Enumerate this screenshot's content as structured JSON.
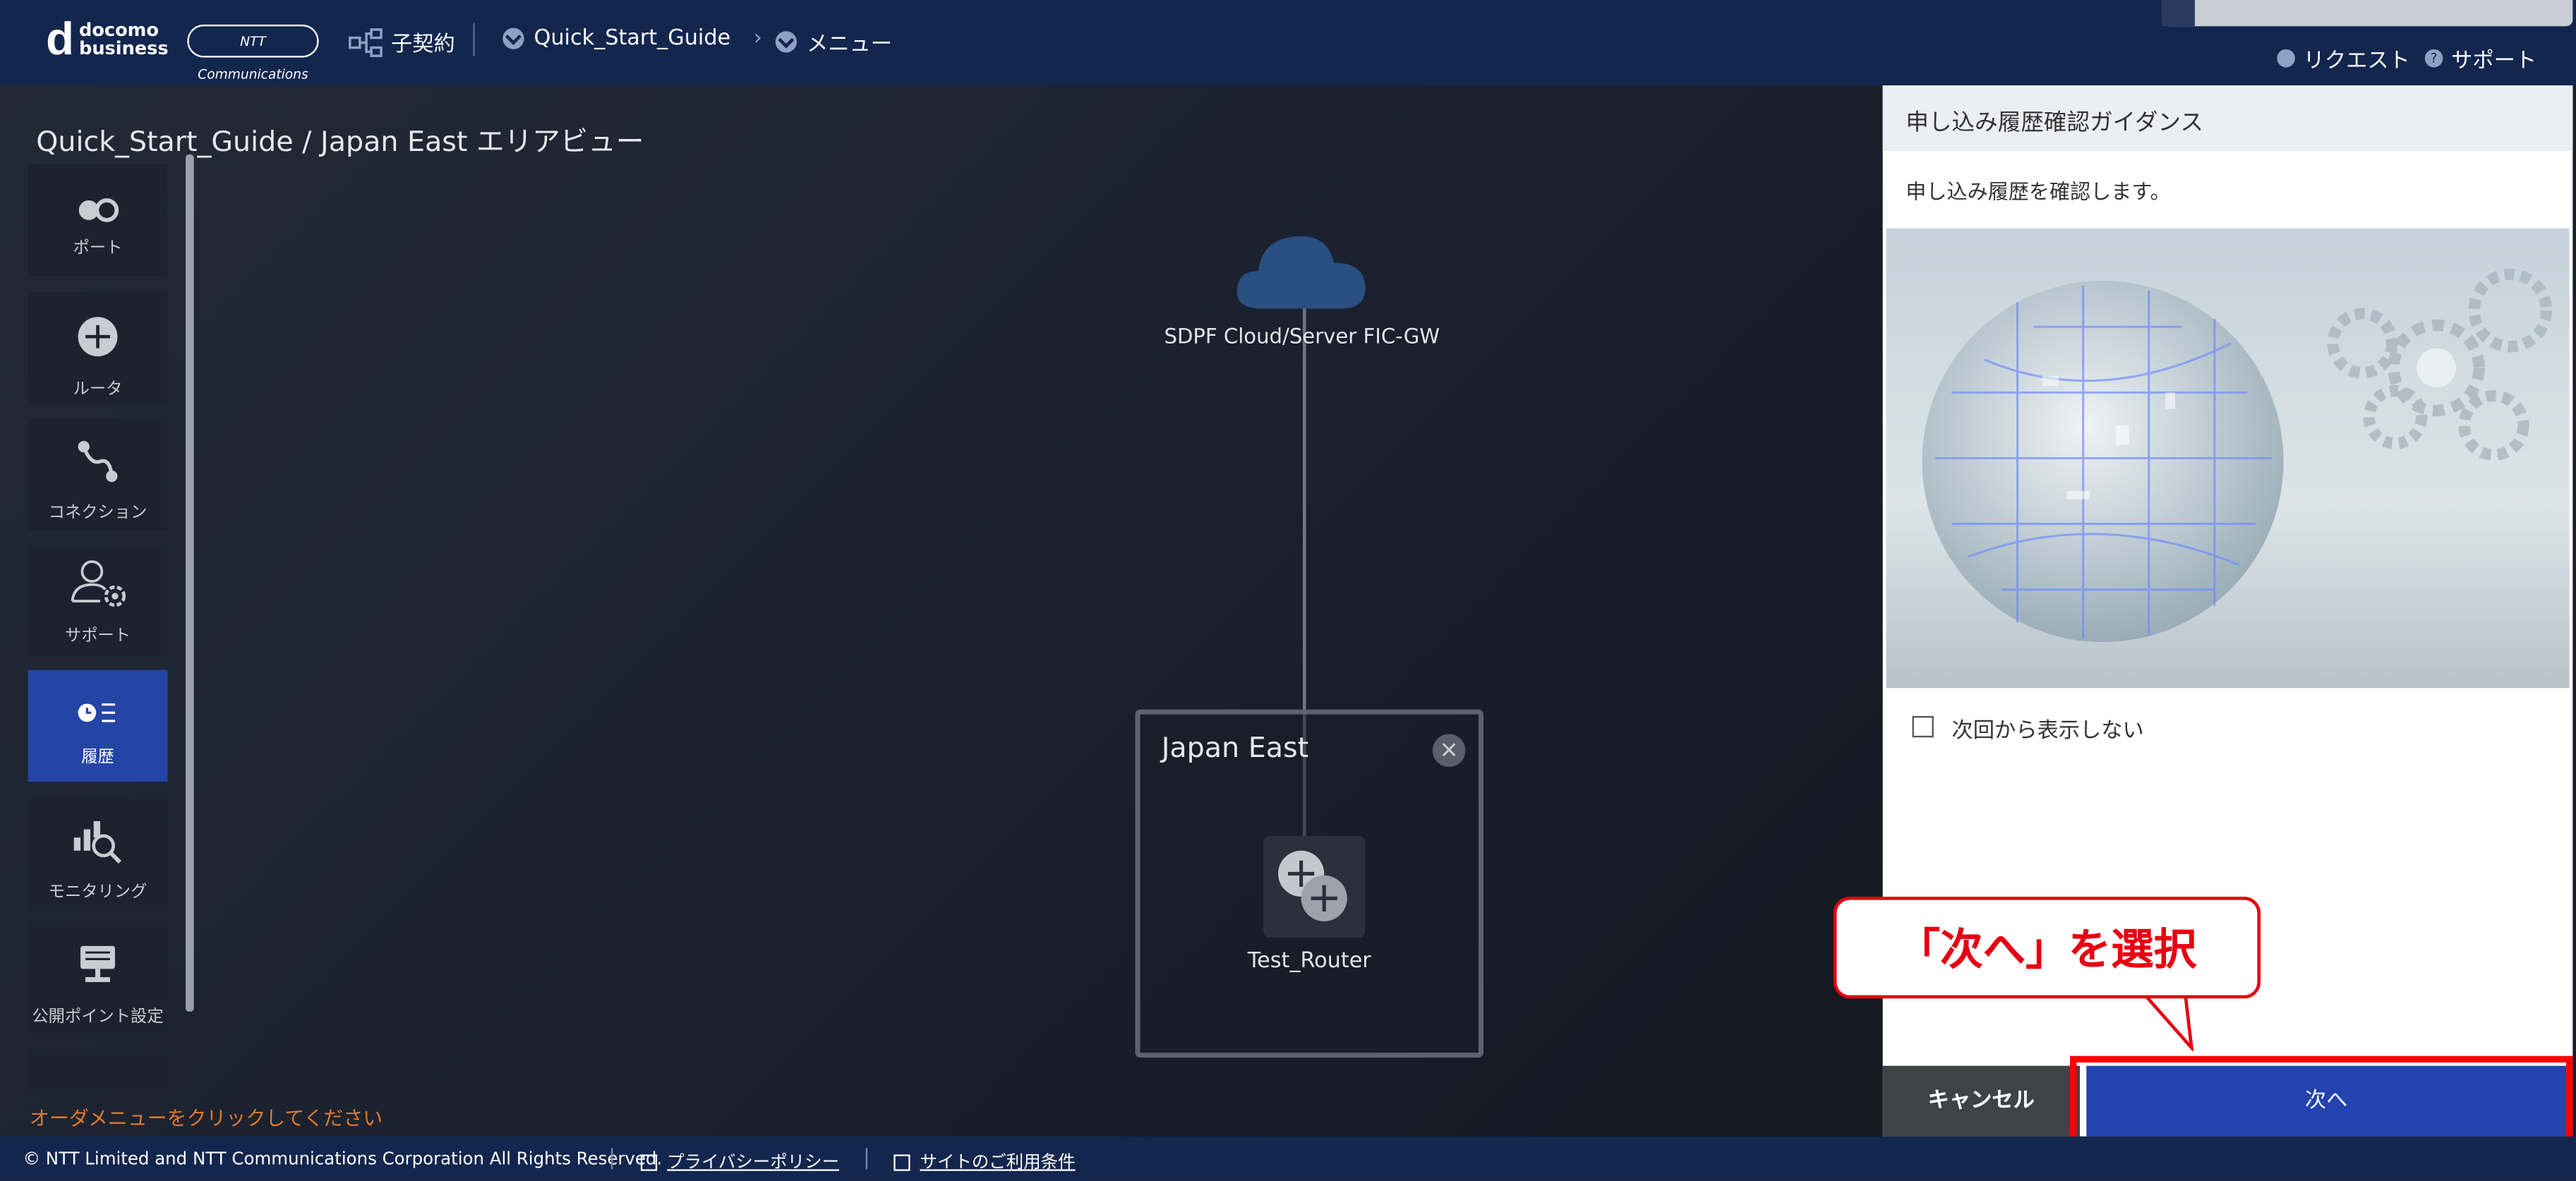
{
  "header": {
    "logo_d": "d",
    "logo_line1": "docomo",
    "logo_line2": "business",
    "ntt_logo": "NTT Communications",
    "contract": "子契約",
    "breadcrumb1": "Quick_Start_Guide",
    "breadcrumb2": "メニュー",
    "request": "リクエスト",
    "support": "サポート"
  },
  "canvas": {
    "title": "Quick_Start_Guide / Japan East エリアビュー",
    "side_menu": [
      {
        "label": "ポート",
        "icon": "port-icon"
      },
      {
        "label": "ルータ",
        "icon": "router-icon"
      },
      {
        "label": "コネクション",
        "icon": "connection-icon"
      },
      {
        "label": "サポート",
        "icon": "support-icon"
      },
      {
        "label": "履歴",
        "icon": "history-icon",
        "active": true
      },
      {
        "label": "モニタリング",
        "icon": "monitoring-icon"
      },
      {
        "label": "公開ポイント設定",
        "icon": "public-point-icon"
      }
    ],
    "cloud_label": "SDPF Cloud/Server FIC-GW",
    "region_title": "Japan East",
    "router_label": "Test_Router",
    "hint": "オーダメニューをクリックしてください"
  },
  "panel": {
    "title": "申し込み履歴確認ガイダンス",
    "description": "申し込み履歴を確認します。",
    "checkbox_label": "次回から表示しない",
    "cancel": "キャンセル",
    "next": "次へ"
  },
  "callout": {
    "text": "「次へ」を選択"
  },
  "footer": {
    "copyright": "© NTT Limited and NTT Communications Corporation All Rights Reserved.",
    "privacy": "プライバシーポリシー",
    "terms": "サイトのご利用条件"
  },
  "colors": {
    "header_bg": "#13264e",
    "active_menu": "#2445a6",
    "next_button": "#2243b0",
    "annotation_red": "#e60012",
    "hint_orange": "#e07a2a"
  }
}
